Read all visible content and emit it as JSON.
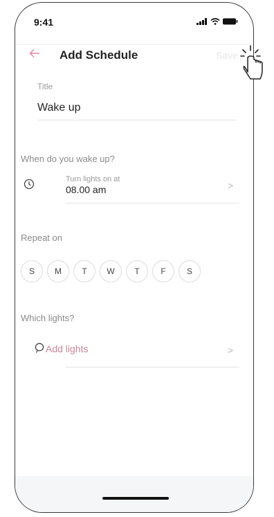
{
  "status_bar": {
    "time": "9:41"
  },
  "header": {
    "back_icon": "arrow-left-icon",
    "title": "Add Schedule",
    "save_label": "Save"
  },
  "title_field": {
    "label": "Title",
    "value": "Wake up"
  },
  "wake": {
    "question": "When do you wake up?",
    "sub_label": "Turn lights on at",
    "time_value": "08.00 am",
    "icon": "clock-icon"
  },
  "repeat": {
    "label": "Repeat on",
    "days": [
      "S",
      "M",
      "T",
      "W",
      "T",
      "F",
      "S"
    ]
  },
  "lights": {
    "question": "Which lights?",
    "add_label": "Add lights",
    "icon": "bulb-icon"
  },
  "colors": {
    "accent": "#e0889a",
    "accent_text": "#c98797",
    "muted": "#9a9a9a"
  }
}
